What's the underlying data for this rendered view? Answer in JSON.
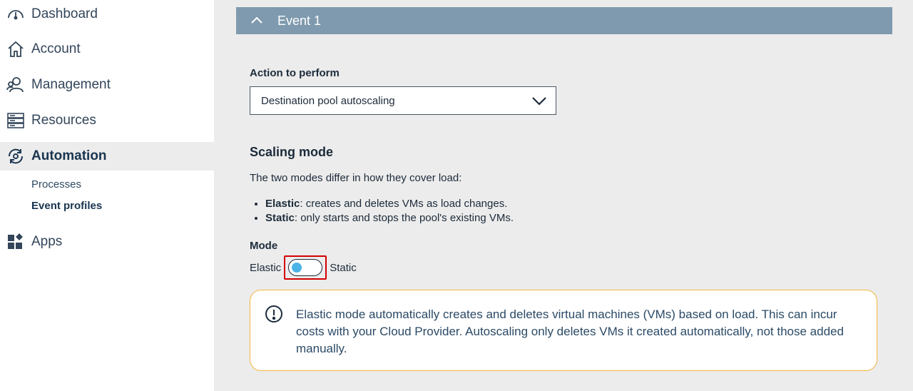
{
  "sidebar": {
    "items": [
      {
        "label": "Dashboard",
        "icon": "gauge-icon"
      },
      {
        "label": "Account",
        "icon": "home-icon"
      },
      {
        "label": "Management",
        "icon": "users-icon"
      },
      {
        "label": "Resources",
        "icon": "server-icon"
      },
      {
        "label": "Automation",
        "icon": "automation-icon",
        "active": true
      },
      {
        "label": "Apps",
        "icon": "apps-icon"
      }
    ],
    "subitems": [
      {
        "label": "Processes"
      },
      {
        "label": "Event profiles",
        "active": true
      }
    ]
  },
  "main": {
    "event_title": "Event 1",
    "action_label": "Action to perform",
    "action_value": "Destination pool autoscaling",
    "scaling_title": "Scaling mode",
    "scaling_desc": "The two modes differ in how they cover load:",
    "bullets": [
      {
        "term": "Elastic",
        "text": ": creates and deletes VMs as load changes."
      },
      {
        "term": "Static",
        "text": ": only starts and stops the pool's existing VMs."
      }
    ],
    "mode_label": "Mode",
    "mode_left": "Elastic",
    "mode_right": "Static",
    "toggle_state": "Elastic",
    "notice_text": "Elastic mode automatically creates and deletes virtual machines (VMs) based on load. This can incur costs with your Cloud Provider. Autoscaling only deletes VMs it created automatically, not those added manually."
  },
  "colors": {
    "accent_header": "#7f9aae",
    "toggle_knob": "#4cb3e6",
    "notice_border": "#f0b840",
    "highlight": "#d40000"
  }
}
